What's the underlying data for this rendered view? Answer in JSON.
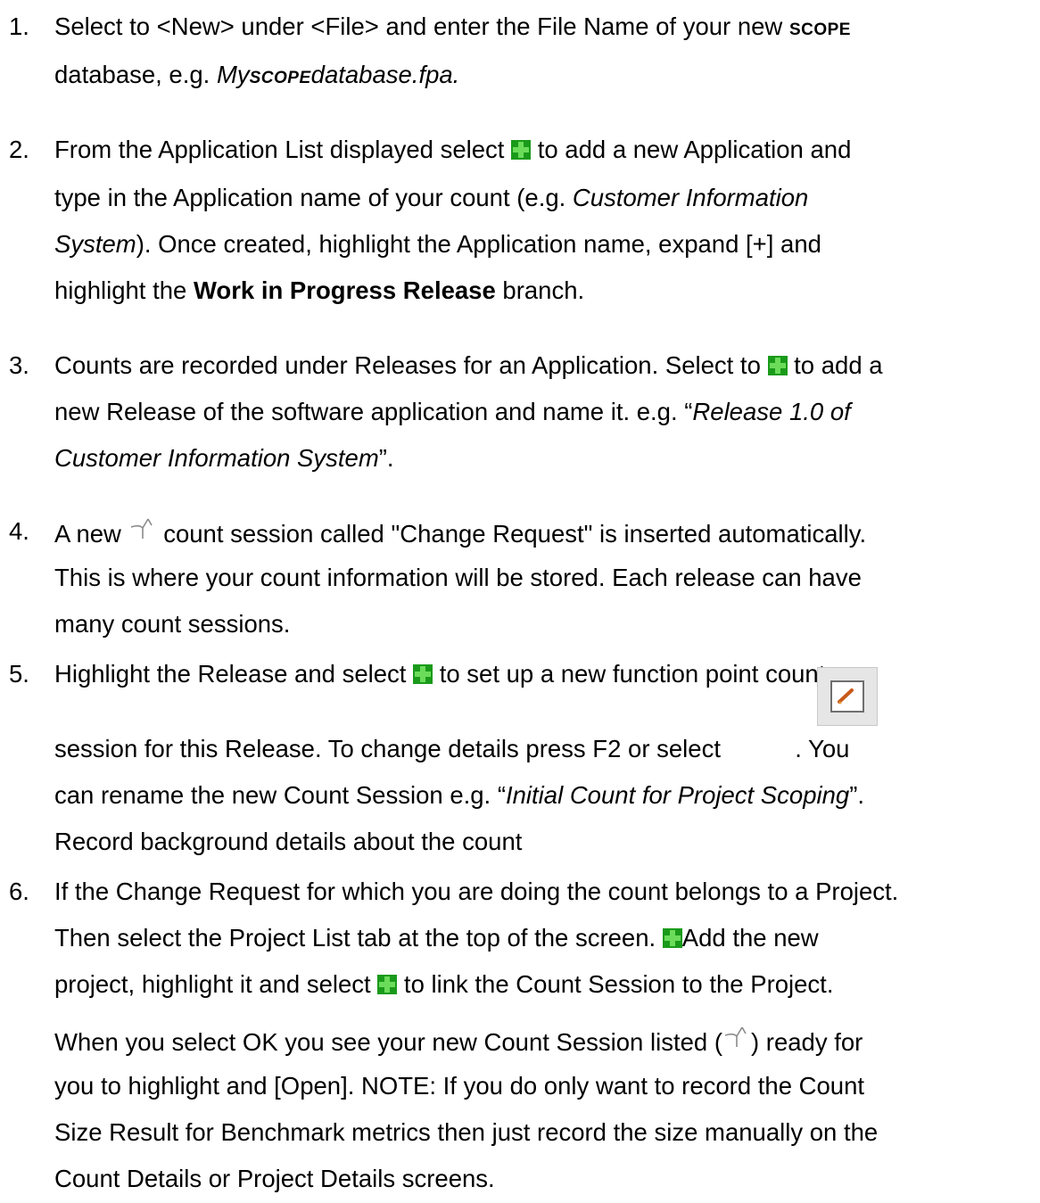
{
  "steps": [
    {
      "num": "1.",
      "lines": [
        {
          "t1": "Select to <New> under <File> and enter the File Name of your new ",
          "scope": "scope"
        },
        {
          "t1": "database, e.g. ",
          "i1": "My",
          "scope": "scope",
          "i2": "database.fpa."
        }
      ]
    },
    {
      "num": "2.",
      "lines": [
        {
          "t1": "From the Application List displayed select ",
          "t2": " to add a new Application and"
        },
        {
          "t1": "type in the Application name of your count   (e.g. ",
          "i1": "Customer Information"
        },
        {
          "i1": "System",
          "t1": "). Once created, highlight the Application name, expand [+] and"
        },
        {
          "t1": "highlight the ",
          "b1": "Work in Progress Release",
          "t2": " branch."
        }
      ]
    },
    {
      "num": "3.",
      "lines": [
        {
          "t1": "Counts are recorded under Releases for an Application.  Select to ",
          "t2": " to add a"
        },
        {
          "t1": "new Release of the software application and name it. e.g.  “",
          "i1": "Release 1.0 of"
        },
        {
          "i1": "Customer Information System",
          "t1": "”."
        }
      ]
    },
    {
      "num": "4.",
      "lines": [
        {
          "t1": "A new ",
          "t2": " count session called \"Change Request\" is inserted automatically."
        },
        {
          "t1": " This is where your count information will be stored.  Each release can have"
        },
        {
          "t1": "many count sessions."
        }
      ]
    },
    {
      "num": "5.",
      "lines": [
        {
          "t1": "Highlight the Release and select ",
          "t2": "  to set up a new function point count"
        },
        {
          "t1": "session for this Release.   To change details press F2 or select ",
          "t2": " . You"
        },
        {
          "t1": "can rename the new Count Session e.g. “",
          "i1": "Initial Count for Project Scoping",
          "t2": "”."
        },
        {
          "t1": "Record background details about the count"
        }
      ]
    },
    {
      "num": "6.",
      "lines": [
        {
          "t1": "If the Change Request for which you are doing the count belongs to a Project."
        },
        {
          "t1": " Then select the Project List tab at the top of the screen.  ",
          "t2": "Add the new"
        },
        {
          "t1": "project, highlight it and select  ",
          "t2": " to link the Count Session to the Project."
        },
        {
          "t1": " When you select OK you see your new Count Session listed (",
          "t2": ") ready for"
        },
        {
          "t1": "you to highlight and [Open].  NOTE: If you do only want to record the Count"
        },
        {
          "t1": "Size Result for Benchmark metrics then just record the size manually on the"
        },
        {
          "t1": "Count Details or Project Details screens."
        }
      ]
    }
  ],
  "icons": {
    "add": "green-plus-icon",
    "count_session": "compass-icon",
    "edit": "edit-details-icon"
  },
  "colors": {
    "plus_dark": "#1a9a1a",
    "plus_light": "#6bdc5a"
  }
}
